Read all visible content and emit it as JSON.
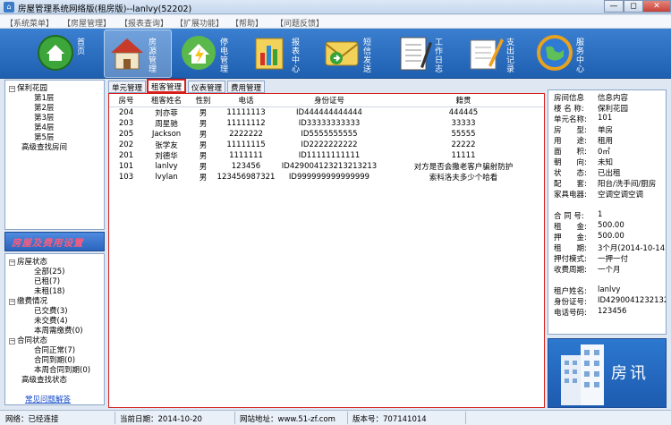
{
  "window": {
    "title": "房屋管理系统网络版(租房版)--lanlvy(52202)",
    "minimize": "—",
    "maximize": "◻",
    "close": "✕"
  },
  "menu": [
    "【系统菜单】",
    "【房屋管理】",
    "【报表查询】",
    "【扩展功能】",
    "【帮助】",
    "【问题反馈】"
  ],
  "toolbar": [
    {
      "label": "首页",
      "icon": "home-icon"
    },
    {
      "label": "房源管理",
      "icon": "house-icon"
    },
    {
      "label": "停电管理",
      "icon": "house-lightning-icon"
    },
    {
      "label": "报表中心",
      "icon": "chart-icon"
    },
    {
      "label": "短信发送",
      "icon": "envelope-icon"
    },
    {
      "label": "工作日志",
      "icon": "notebook-icon"
    },
    {
      "label": "支出记录",
      "icon": "pen-paper-icon"
    },
    {
      "label": "服务中心",
      "icon": "globe-icon"
    }
  ],
  "tree_top": {
    "root": "保利花园",
    "floors": [
      "第1层",
      "第2层",
      "第3层",
      "第4层",
      "第5层"
    ],
    "search": "高级查找房间"
  },
  "left_banner": "房屋及费用设置",
  "tree_bottom": {
    "house_status": "房屋状态",
    "house_items": [
      "全部(25)",
      "已租(7)",
      "未租(18)"
    ],
    "fee_status": "缴费情况",
    "fee_items": [
      "已交费(3)",
      "未交费(4)",
      "本周需缴费(0)"
    ],
    "contract_status": "合同状态",
    "contract_items": [
      "合同正常(7)",
      "合同到期(0)",
      "本周合同到期(0)"
    ],
    "advanced": "高级查找状态",
    "help": "常见问题解答"
  },
  "tabs": [
    "单元管理",
    "租客管理",
    "仪表管理",
    "费用管理"
  ],
  "table": {
    "headers": [
      "房号",
      "租客姓名",
      "性别",
      "电话",
      "身份证号",
      "籍贯"
    ],
    "rows": [
      [
        "204",
        "刘亦菲",
        "男",
        "11111113",
        "ID444444444444",
        "444445"
      ],
      [
        "203",
        "周星驰",
        "男",
        "11111112",
        "ID33333333333",
        "33333"
      ],
      [
        "205",
        "Jackson",
        "男",
        "2222222",
        "ID5555555555",
        "55555"
      ],
      [
        "202",
        "张学友",
        "男",
        "11111115",
        "ID2222222222",
        "22222"
      ],
      [
        "201",
        "刘德华",
        "男",
        "1111111",
        "ID11111111111",
        "11111"
      ],
      [
        "101",
        "lanlvy",
        "男",
        "123456",
        "ID429004123213213213",
        "对方是否会撒老客户骗射防护"
      ],
      [
        "103",
        "lvylan",
        "男",
        "123456987321",
        "ID999999999999999",
        "索科洛夫多少个哈看"
      ]
    ]
  },
  "info": {
    "hdr_key": "房间信息",
    "hdr_val": "信息内容",
    "rows": [
      [
        "楼 名 称:",
        "保利花园"
      ],
      [
        "单元名称:",
        "101"
      ],
      [
        "房　　型:",
        "单房"
      ],
      [
        "用　　途:",
        "租用"
      ],
      [
        "面　　积:",
        "0㎡"
      ],
      [
        "朝　　向:",
        "未知"
      ],
      [
        "状　　态:",
        "已出租"
      ],
      [
        "配　　套:",
        "阳台/洗手间/厨房"
      ],
      [
        "家具电器:",
        "空调空调空调"
      ],
      [
        "",
        ""
      ],
      [
        "合 同 号:",
        "1"
      ],
      [
        "租　　金:",
        "500.00"
      ],
      [
        "押　　金:",
        "500.00"
      ],
      [
        "租　　期:",
        "3个月(2014-10-14)"
      ],
      [
        "押付模式:",
        "一押一付"
      ],
      [
        "收费周期:",
        "一个月"
      ],
      [
        "",
        ""
      ],
      [
        "租户姓名:",
        "lanlvy"
      ],
      [
        "身份证号:",
        "ID429004123213213"
      ],
      [
        "电话号码:",
        "123456"
      ]
    ]
  },
  "logo_text": "房讯",
  "status": {
    "network": "网络：已经连接",
    "date": "当前日期：2014-10-20",
    "site": "网站地址：www.51-zf.com",
    "version": "版本号：707141014"
  }
}
